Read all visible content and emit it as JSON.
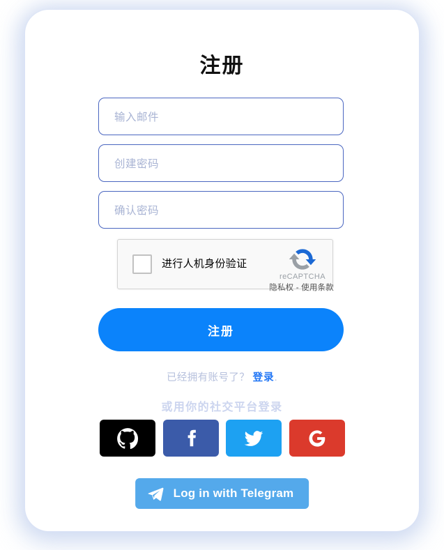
{
  "page": {
    "background_color": "#ffffff",
    "card_background": "#ffffff"
  },
  "form": {
    "title": "注册",
    "fields": [
      {
        "name": "email",
        "placeholder": "输入邮件"
      },
      {
        "name": "password",
        "placeholder": "创建密码"
      },
      {
        "name": "confirm_password",
        "placeholder": "确认密码"
      }
    ],
    "submit_label": "注册"
  },
  "recaptcha": {
    "checkbox_label": "进行人机身份验证",
    "brand": "reCAPTCHA",
    "terms": "隐私权 - 使用条款",
    "logo_icon": "recaptcha-refresh-icon",
    "checked": false,
    "background_color": "#f9f9f9",
    "border_color": "#d3d3d3"
  },
  "login_prompt": {
    "text": "已经拥有账号了？",
    "link_label": "登录",
    "suffix": ".",
    "link_color": "#2176f5"
  },
  "social": {
    "heading": "或用你的社交平台登录",
    "heading_color": "#ccd5ef",
    "buttons": [
      {
        "name": "github",
        "icon": "github-icon",
        "color": "#000000",
        "label": "GitHub"
      },
      {
        "name": "facebook",
        "icon": "facebook-icon",
        "color": "#3b5ba9",
        "label": "Facebook"
      },
      {
        "name": "twitter",
        "icon": "twitter-icon",
        "color": "#1da1f2",
        "label": "Twitter"
      },
      {
        "name": "google",
        "icon": "google-icon",
        "color": "#db3a2c",
        "label": "Google"
      }
    ]
  },
  "telegram": {
    "label": "Log in with Telegram",
    "icon": "telegram-paper-plane-icon",
    "color": "#54a9eb"
  },
  "theme": {
    "accent": "#0b83fb",
    "input_border": "#4a66c0",
    "placeholder": "#a9b4d4"
  }
}
